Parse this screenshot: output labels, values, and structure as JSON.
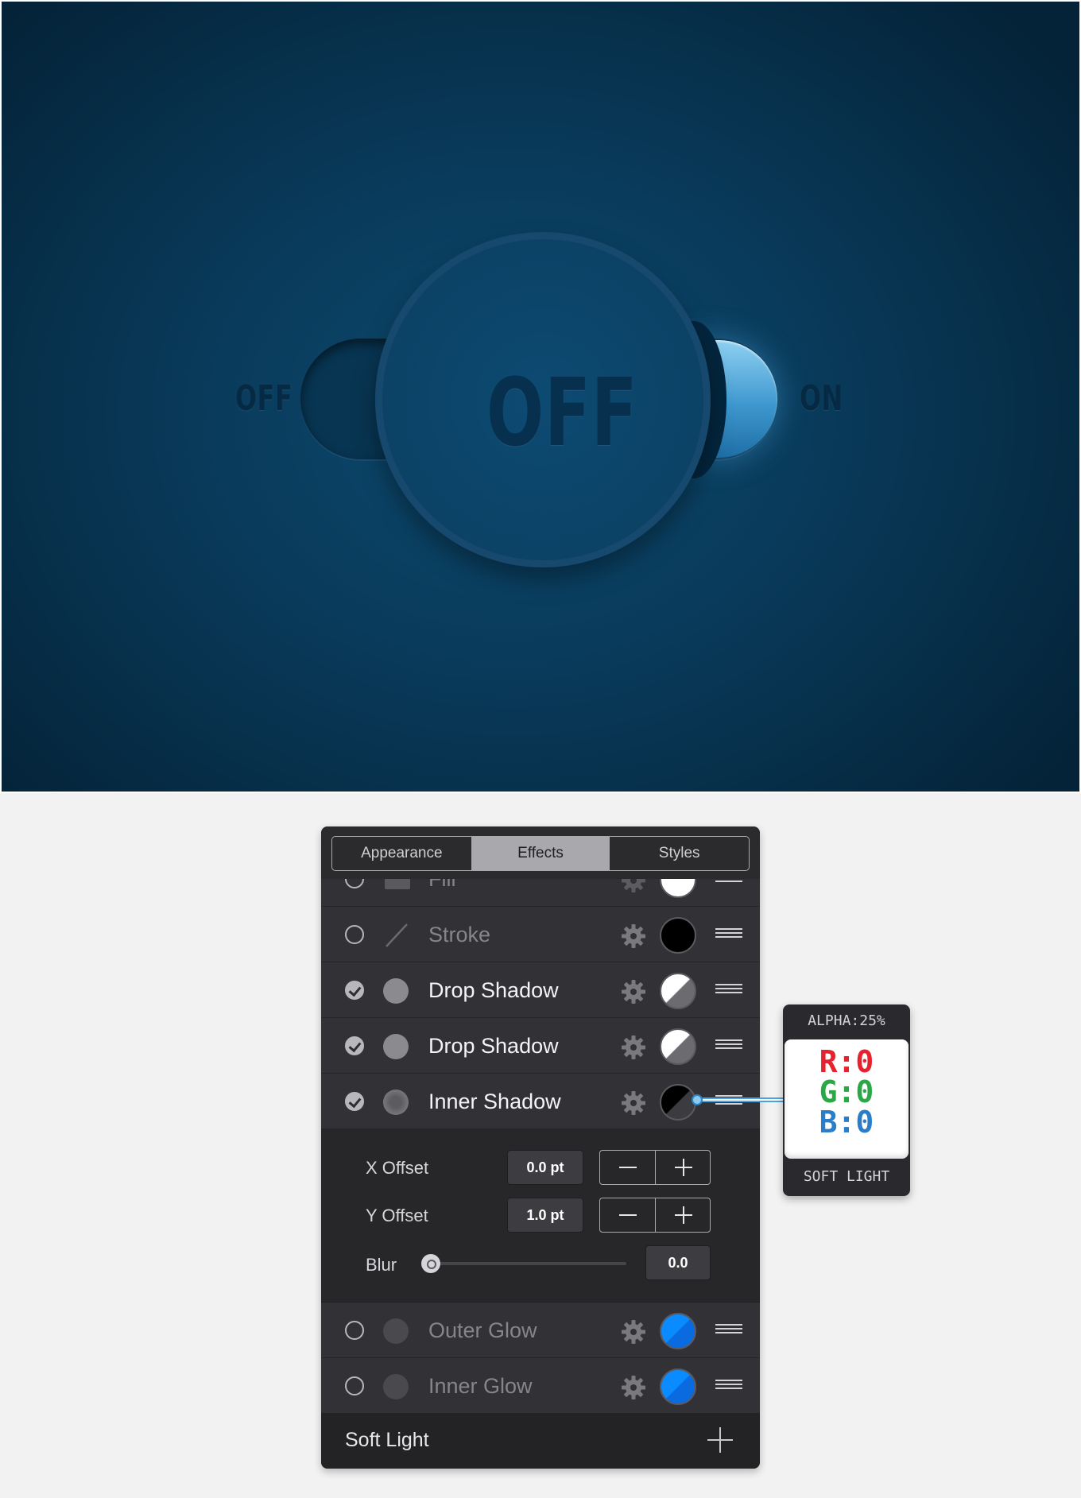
{
  "preview": {
    "off_small": "OFF",
    "off_big": "OFF",
    "on_small": "ON"
  },
  "panel": {
    "tabs": [
      {
        "label": "Appearance",
        "active": false
      },
      {
        "label": "Effects",
        "active": true
      },
      {
        "label": "Styles",
        "active": false
      }
    ],
    "effects": [
      {
        "label": "Fill",
        "enabled": false,
        "icon": "fill-square-icon",
        "swatch": "white"
      },
      {
        "label": "Stroke",
        "enabled": false,
        "icon": "stroke-line-icon",
        "swatch": "black"
      },
      {
        "label": "Drop Shadow",
        "enabled": true,
        "icon": "shadow-circle-icon",
        "swatch": "white-gray-split"
      },
      {
        "label": "Drop Shadow",
        "enabled": true,
        "icon": "shadow-circle-icon",
        "swatch": "white-gray-split"
      },
      {
        "label": "Inner Shadow",
        "enabled": true,
        "icon": "inner-shadow-circle-icon",
        "swatch": "black-gray-split"
      },
      {
        "label": "Outer Glow",
        "enabled": false,
        "icon": "glow-circle-icon",
        "swatch": "blue"
      },
      {
        "label": "Inner Glow",
        "enabled": false,
        "icon": "glow-circle-icon",
        "swatch": "blue"
      }
    ],
    "settings": {
      "x_offset_label": "X Offset",
      "x_offset_value": "0.0 pt",
      "y_offset_label": "Y Offset",
      "y_offset_value": "1.0 pt",
      "blur_label": "Blur",
      "blur_value": "0.0",
      "blur_fraction": 0.0
    },
    "footer": {
      "blend_mode": "Soft Light"
    }
  },
  "tooltip": {
    "alpha": "ALPHA:25%",
    "r": "R:0",
    "g": "G:0",
    "b": "B:0",
    "mode": "SOFT LIGHT"
  },
  "colors": {
    "accent_blue": "#0a8bff",
    "red": "#e8212e",
    "green": "#2aa845",
    "blue": "#2a7ec9"
  }
}
